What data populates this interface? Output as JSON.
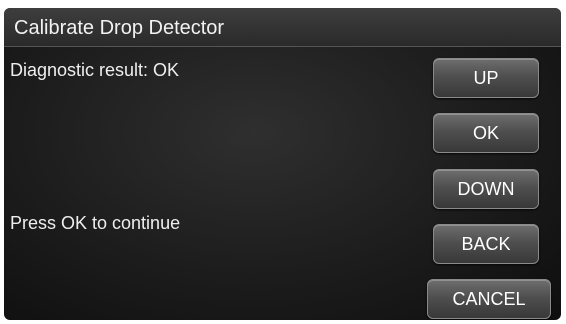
{
  "window": {
    "title": "Calibrate Drop Detector"
  },
  "main": {
    "result_text": "Diagnostic result: OK",
    "prompt_text": "Press OK to continue"
  },
  "buttons": {
    "up": "UP",
    "ok": "OK",
    "down": "DOWN",
    "back": "BACK",
    "cancel": "CANCEL"
  },
  "colors": {
    "background": "#1c1c1c",
    "title_bar": "#333333",
    "text": "#eeeeee",
    "button": "#555555"
  }
}
